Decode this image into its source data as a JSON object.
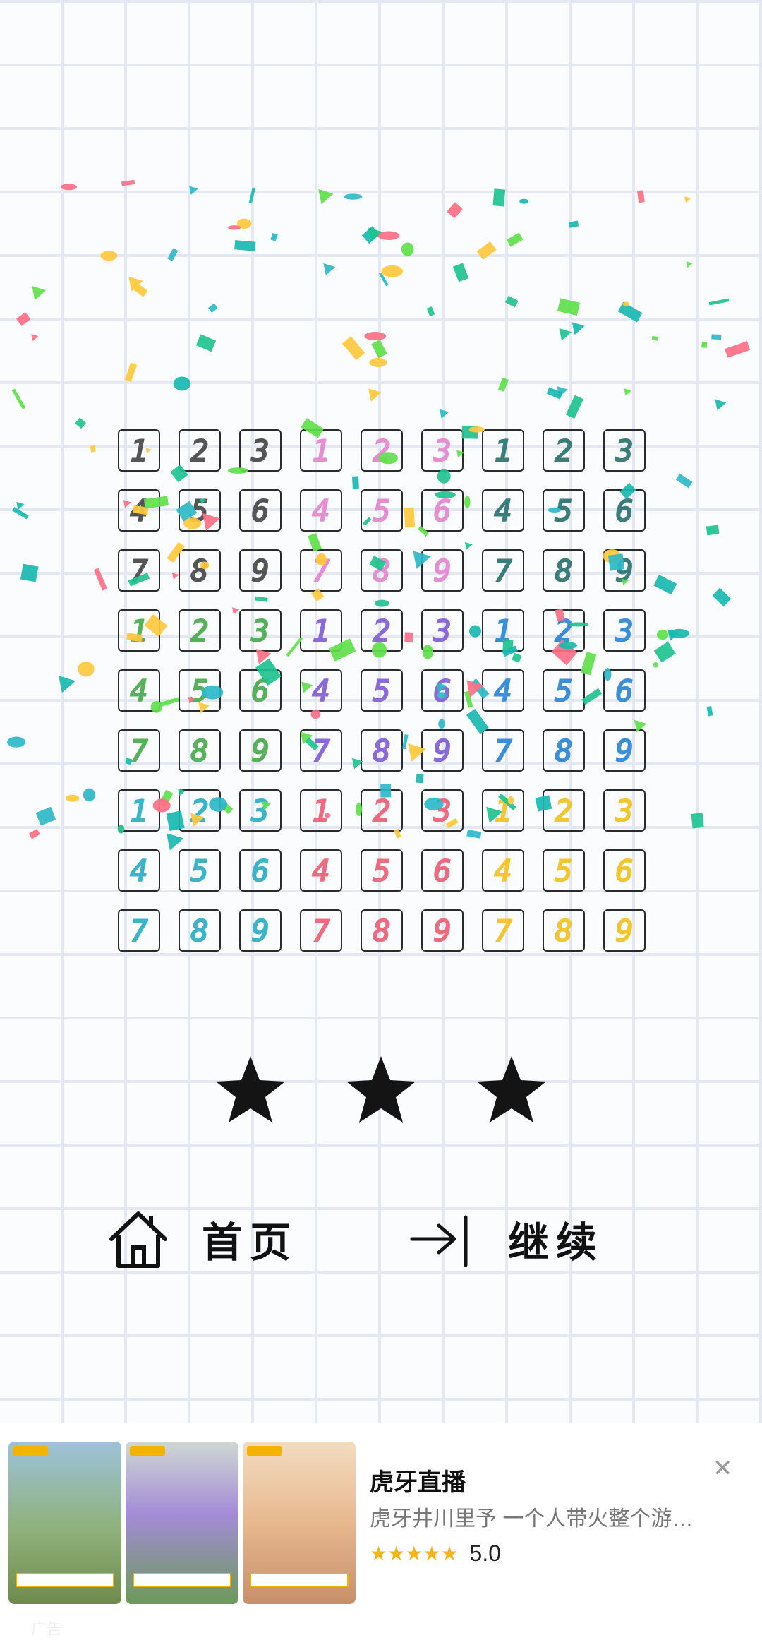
{
  "board": {
    "rows": [
      [
        "1",
        "2",
        "3",
        "1",
        "2",
        "3",
        "1",
        "2",
        "3"
      ],
      [
        "4",
        "5",
        "6",
        "4",
        "5",
        "6",
        "4",
        "5",
        "6"
      ],
      [
        "7",
        "8",
        "9",
        "7",
        "8",
        "9",
        "7",
        "8",
        "9"
      ],
      [
        "1",
        "2",
        "3",
        "1",
        "2",
        "3",
        "1",
        "2",
        "3"
      ],
      [
        "4",
        "5",
        "6",
        "4",
        "5",
        "6",
        "4",
        "5",
        "6"
      ],
      [
        "7",
        "8",
        "9",
        "7",
        "8",
        "9",
        "7",
        "8",
        "9"
      ],
      [
        "1",
        "2",
        "3",
        "1",
        "2",
        "3",
        "1",
        "2",
        "3"
      ],
      [
        "4",
        "5",
        "6",
        "4",
        "5",
        "6",
        "4",
        "5",
        "6"
      ],
      [
        "7",
        "8",
        "9",
        "7",
        "8",
        "9",
        "7",
        "8",
        "9"
      ]
    ],
    "block_colors": [
      [
        "#555555",
        "#e58ed2",
        "#3a7d7a"
      ],
      [
        "#57b05a",
        "#8a6ad8",
        "#3b8fd8"
      ],
      [
        "#3bb3c8",
        "#ee6a7e",
        "#f3c62f"
      ]
    ]
  },
  "stars": {
    "earned": 3,
    "total": 3
  },
  "nav": {
    "home_label": "首页",
    "continue_label": "继续"
  },
  "ad": {
    "title": "虎牙直播",
    "description": "虎牙井川里予 一个人带火整个游…",
    "rating": "5.0",
    "star_count": 5,
    "mark": "广告",
    "close_symbol": "✕"
  },
  "confetti_colors": [
    "#1ec38f",
    "#ffc93c",
    "#19b8b0",
    "#ff6e86",
    "#5ee04a",
    "#2db8c8"
  ]
}
